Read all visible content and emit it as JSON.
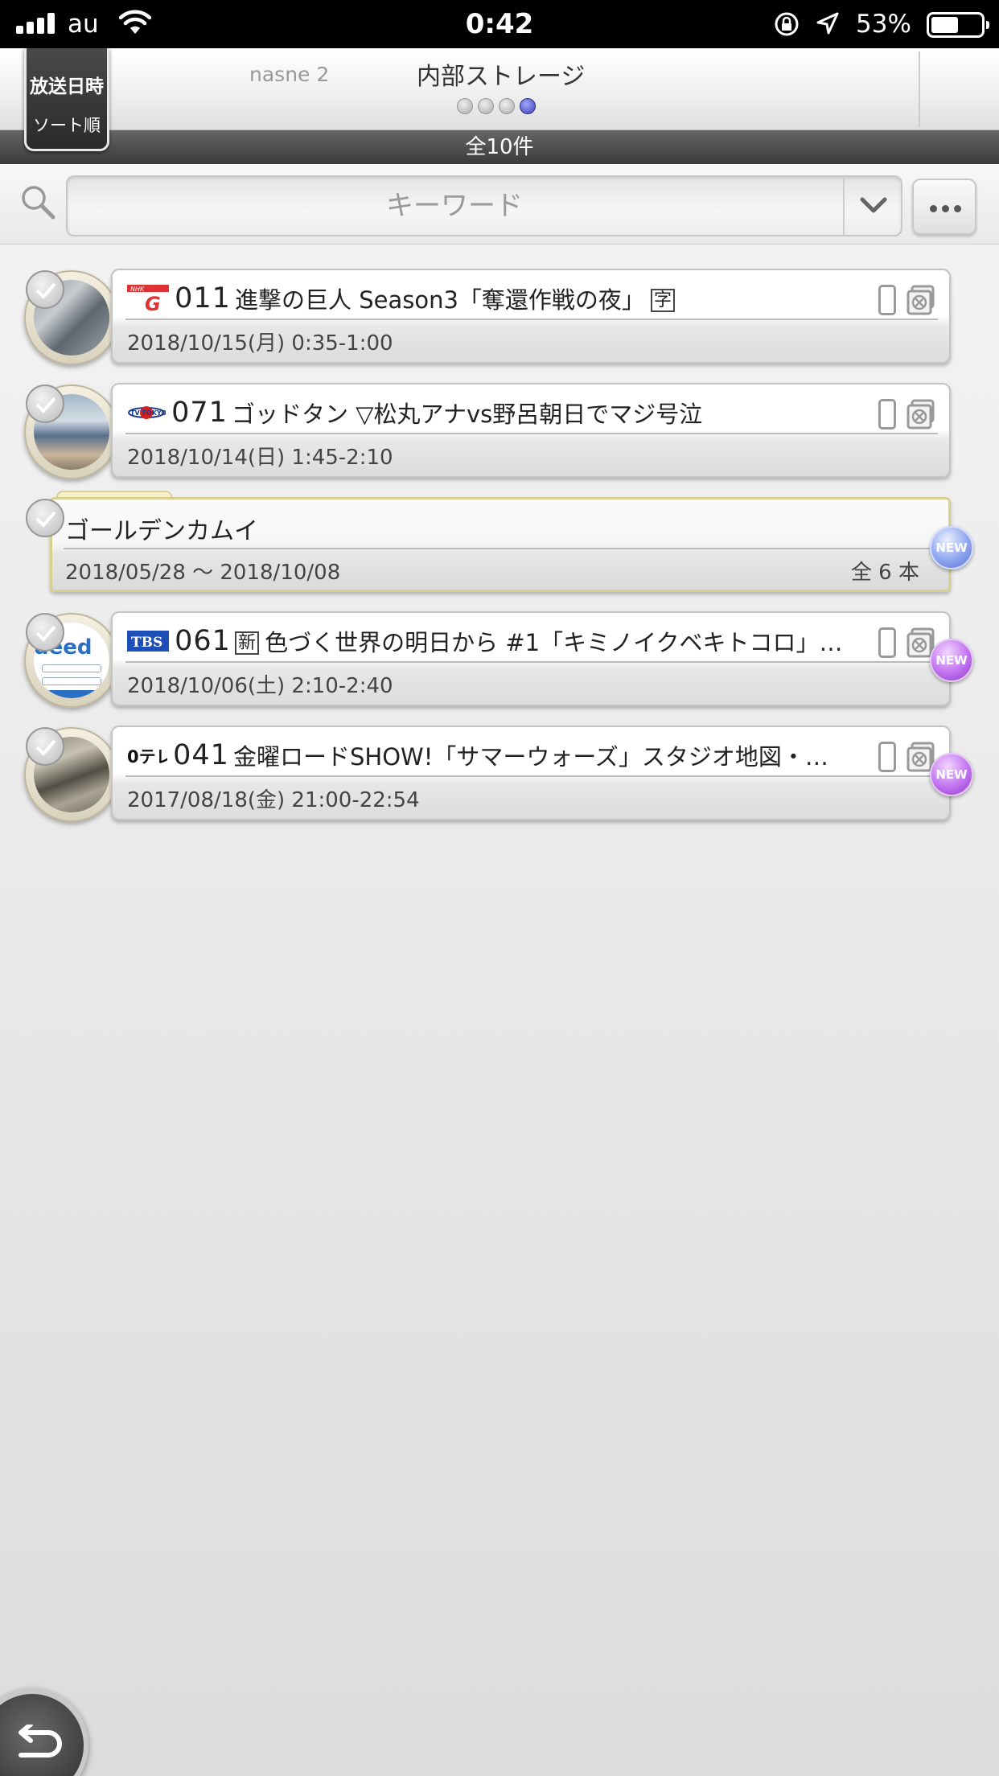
{
  "status_bar": {
    "carrier": "au",
    "time": "0:42",
    "battery": "53%",
    "icons": [
      "signal-icon",
      "wifi-icon",
      "rotation-lock-icon",
      "location-icon",
      "battery-icon"
    ]
  },
  "header": {
    "sort_button": {
      "line1": "放送日時",
      "line2": "ソート順"
    },
    "tabs": [
      "nasne 2",
      "内部ストレージ"
    ],
    "page_indicator": {
      "total": 4,
      "active_index": 3
    }
  },
  "count_text": "全10件",
  "search": {
    "placeholder": "キーワード",
    "value": ""
  },
  "items": [
    {
      "type": "recording",
      "channel_logo": "NHK G",
      "channel_number": "011",
      "title": "進撃の巨人 Season3「奪還作戦の夜」",
      "title_mark": "字",
      "datetime": "2018/10/15(月) 0:35-1:00",
      "new": false
    },
    {
      "type": "recording",
      "channel_logo": "TV TOKYO",
      "channel_number": "071",
      "title": "ゴッドタン ▽松丸アナvs野呂朝日でマジ号泣",
      "datetime": "2018/10/14(日) 1:45-2:10",
      "new": false
    },
    {
      "type": "series",
      "title": "ゴールデンカムイ",
      "range": "2018/05/28 〜 2018/10/08",
      "count": "全 6 本",
      "badge": "NEW"
    },
    {
      "type": "recording",
      "channel_logo": "TBS",
      "channel_number": "061",
      "title_mark": "新",
      "title": "色づく世界の明日から #1「キミノイクベキトコロ」…",
      "datetime": "2018/10/06(土) 2:10-2:40",
      "badge": "NEW"
    },
    {
      "type": "recording",
      "channel_logo": "日テレ",
      "channel_number": "041",
      "title": "金曜ロードSHOW!「サマーウォーズ」スタジオ地図・…",
      "datetime": "2017/08/18(金) 21:00-22:54",
      "badge": "NEW"
    }
  ]
}
